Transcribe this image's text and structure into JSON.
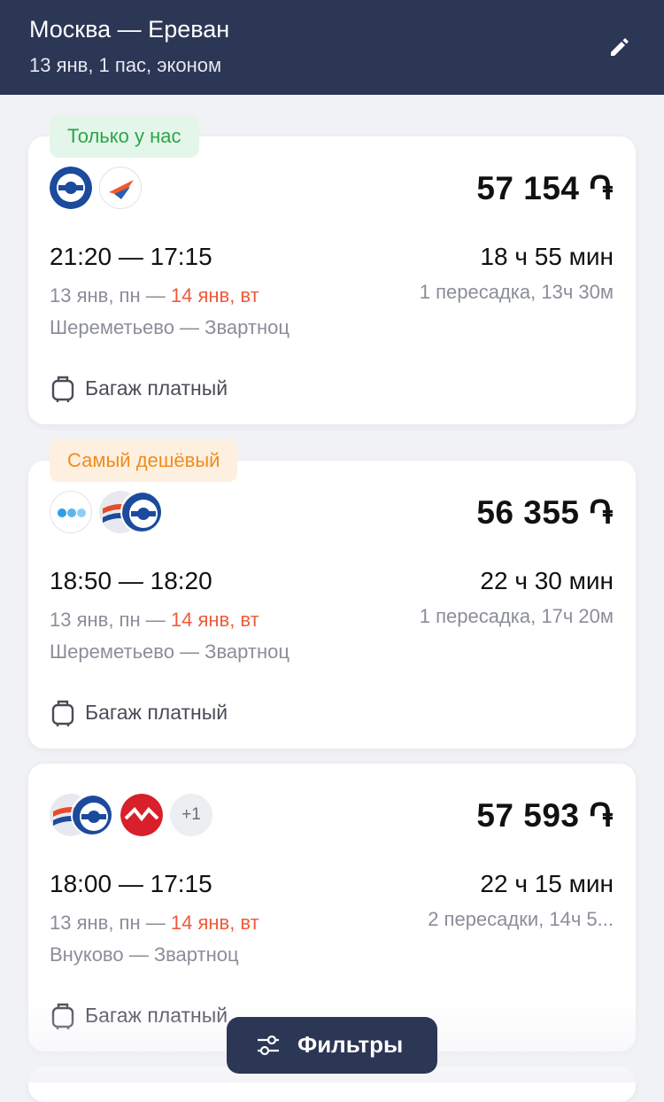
{
  "header": {
    "route": "Москва — Ереван",
    "subtitle": "13 янв, 1 пас, эконом",
    "edit_icon": "pencil-icon"
  },
  "tickets": [
    {
      "badge": "Только у нас",
      "badge_color": "#2aa54a",
      "airlines": [
        "aeroflot-like-logo",
        "orange-arrow-logo"
      ],
      "price": "57 154 ֏",
      "times": "21:20 — 17:15",
      "duration": "18 ч 55 мин",
      "date_from": "13 янв, пн — ",
      "date_to": "14 янв, вт",
      "transfers": "1 пересадка, 13ч 30м",
      "airports": "Шереметьево — Звартноц",
      "baggage": "Багаж платный"
    },
    {
      "badge": "Самый дешёвый",
      "badge_color": "#f08c1c",
      "airlines": [
        "blue-dots-logo",
        "red-swoosh-logo",
        "aeroflot-like-logo"
      ],
      "price": "56 355 ֏",
      "times": "18:50 — 18:20",
      "duration": "22 ч 30 мин",
      "date_from": "13 янв, пн — ",
      "date_to": "14 янв, вт",
      "transfers": "1 пересадка, 17ч 20м",
      "airports": "Шереметьево — Звартноц",
      "baggage": "Багаж платный"
    },
    {
      "airlines": [
        "red-swoosh-logo",
        "aeroflot-like-logo",
        "red-wave-logo"
      ],
      "extra_airlines": "+1",
      "price": "57 593 ֏",
      "times": "18:00 — 17:15",
      "duration": "22 ч 15 мин",
      "date_from": "13 янв, пн — ",
      "date_to": "14 янв, вт",
      "transfers": "2 пересадки, 14ч 5...",
      "airports": "Внуково — Звартноц",
      "baggage": "Багаж платный"
    }
  ],
  "filters_button": {
    "label": "Фильтры",
    "icon": "sliders-icon"
  },
  "colors": {
    "header_bg": "#2c3655",
    "accent_red": "#ef5a3a",
    "muted": "#8b8e99"
  }
}
